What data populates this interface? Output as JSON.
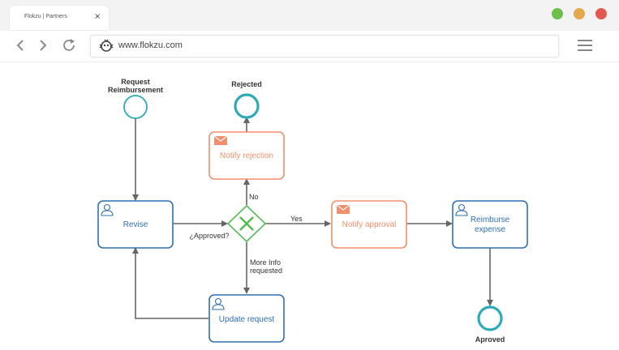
{
  "browser": {
    "tab_title": "Flokzu | Partners",
    "tab_close": "×",
    "url": "www.flokzu.com",
    "dots": [
      "#6cbf4c",
      "#e3a94b",
      "#e05a52"
    ]
  },
  "colors": {
    "task_blue": "#2f6fb3",
    "task_orange": "#f08f6c",
    "event_teal": "#2eaab6",
    "gateway_green": "#58b957",
    "arrow": "#666666"
  },
  "diagram": {
    "start_event_label": [
      "Request",
      "Reimbursement"
    ],
    "rejected_end_label": "Rejected",
    "approved_end_label": "Aproved",
    "tasks": {
      "revise": "Revise",
      "notify_rejection": "Notify rejection",
      "notify_approval": "Notify approval",
      "reimburse": [
        "Reimburse",
        "expense"
      ],
      "update_request": "Update request"
    },
    "gateway_label": "¿Approved?",
    "flows": {
      "no": "No",
      "yes": "Yes",
      "more_info": [
        "More Info",
        "requested"
      ]
    }
  }
}
